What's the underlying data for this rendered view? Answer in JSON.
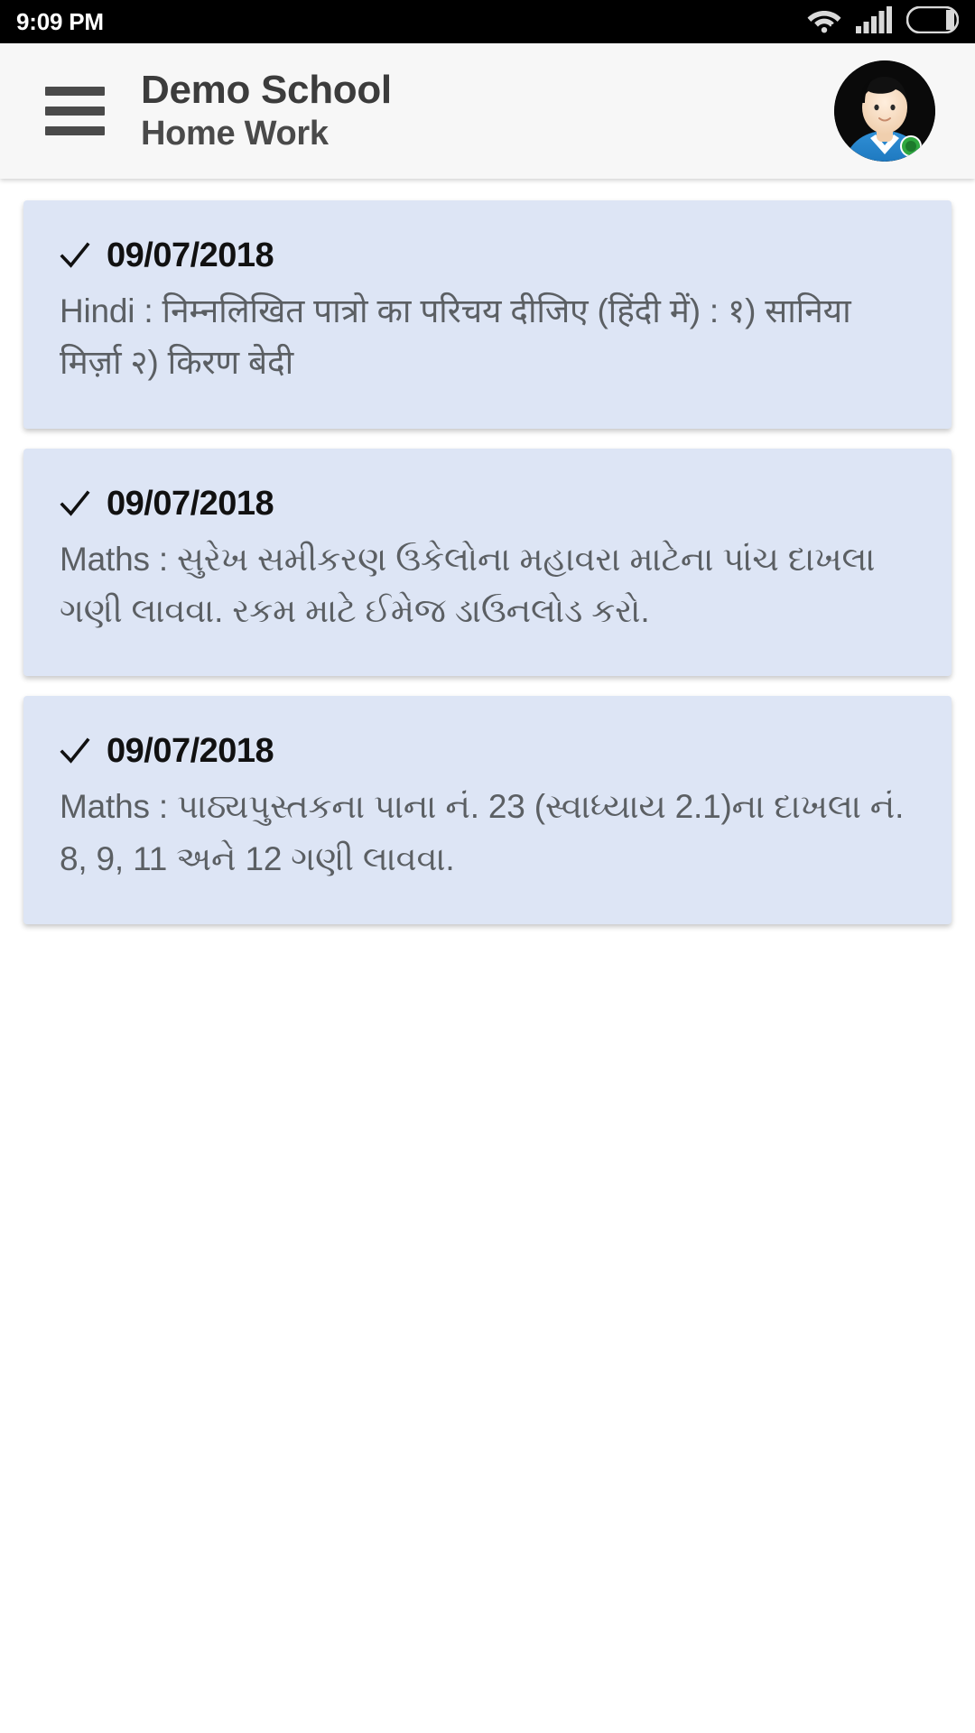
{
  "status_bar": {
    "time": "9:09 PM",
    "icons": [
      "wifi-icon",
      "cellular-signal-icon",
      "battery-icon"
    ]
  },
  "app_bar": {
    "menu_icon": "hamburger-menu-icon",
    "title": "Demo School",
    "subtitle": "Home Work",
    "avatar": "user-avatar"
  },
  "homework_list": [
    {
      "status_icon": "checkmark-icon",
      "date": "09/07/2018",
      "description": "Hindi : निम्नलिखित पात्रो का परिचय दीजिए (हिंदी में) : १) सानिया मिर्ज़ा २) किरण बेदी"
    },
    {
      "status_icon": "checkmark-icon",
      "date": "09/07/2018",
      "description": "Maths : સુરેખ સમીકરણ ઉકેલોના મહાવરા માટેના પાંચ દાખલા ગણી લાવવા. રકમ માટે ઈમેજ ડાઉનલોડ કરો."
    },
    {
      "status_icon": "checkmark-icon",
      "date": "09/07/2018",
      "description": "Maths : પાઠ્યપુસ્તકના પાના નં. 23 (સ્વાધ્યાય 2.1)ના દાખલા નં. 8, 9, 11 અને 12 ગણી લાવવા."
    }
  ],
  "colors": {
    "status_bar_bg": "#000000",
    "app_bar_bg": "#f7f7f7",
    "card_bg": "#dde5f5",
    "page_bg": "#ffffff",
    "title_text": "#3c3c3c",
    "body_text": "#5b5f63"
  }
}
